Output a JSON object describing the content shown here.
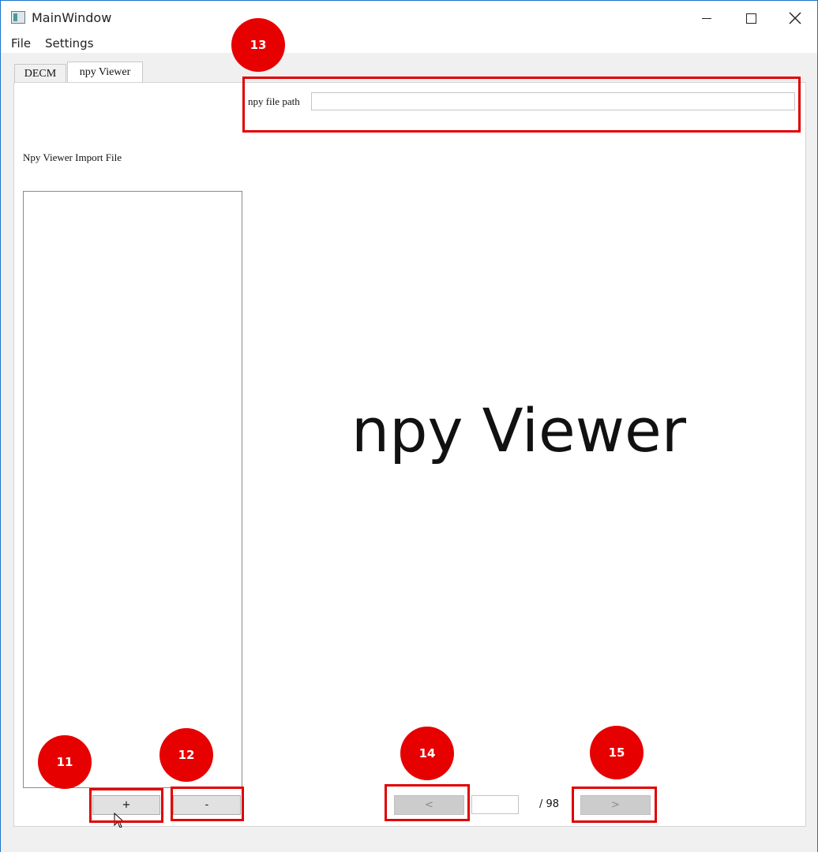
{
  "window": {
    "title": "MainWindow",
    "app_icon": "window-app-icon",
    "controls": [
      "minimize-icon",
      "maximize-icon",
      "close-icon"
    ]
  },
  "menubar": {
    "items": [
      {
        "label": "File"
      },
      {
        "label": "Settings"
      }
    ]
  },
  "tabs": [
    {
      "label": "DECM",
      "active": false
    },
    {
      "label": "npy Viewer",
      "active": true
    }
  ],
  "npy_viewer": {
    "path_label": "npy file path",
    "path_value": "",
    "import_label": "Npy Viewer Import File",
    "file_list": [],
    "display_text": "npy Viewer",
    "add_button": "+",
    "remove_button": "-",
    "prev_button": "<",
    "next_button": ">",
    "page_value": "",
    "page_total": "/ 98"
  },
  "annotations": {
    "badges": [
      "11",
      "12",
      "13",
      "14",
      "15"
    ],
    "color": "#e60000"
  },
  "colors": {
    "window_border": "#1a73c8",
    "background": "#f0f0f0",
    "button": "#e1e1e1",
    "disabled_button": "#cccccc"
  }
}
